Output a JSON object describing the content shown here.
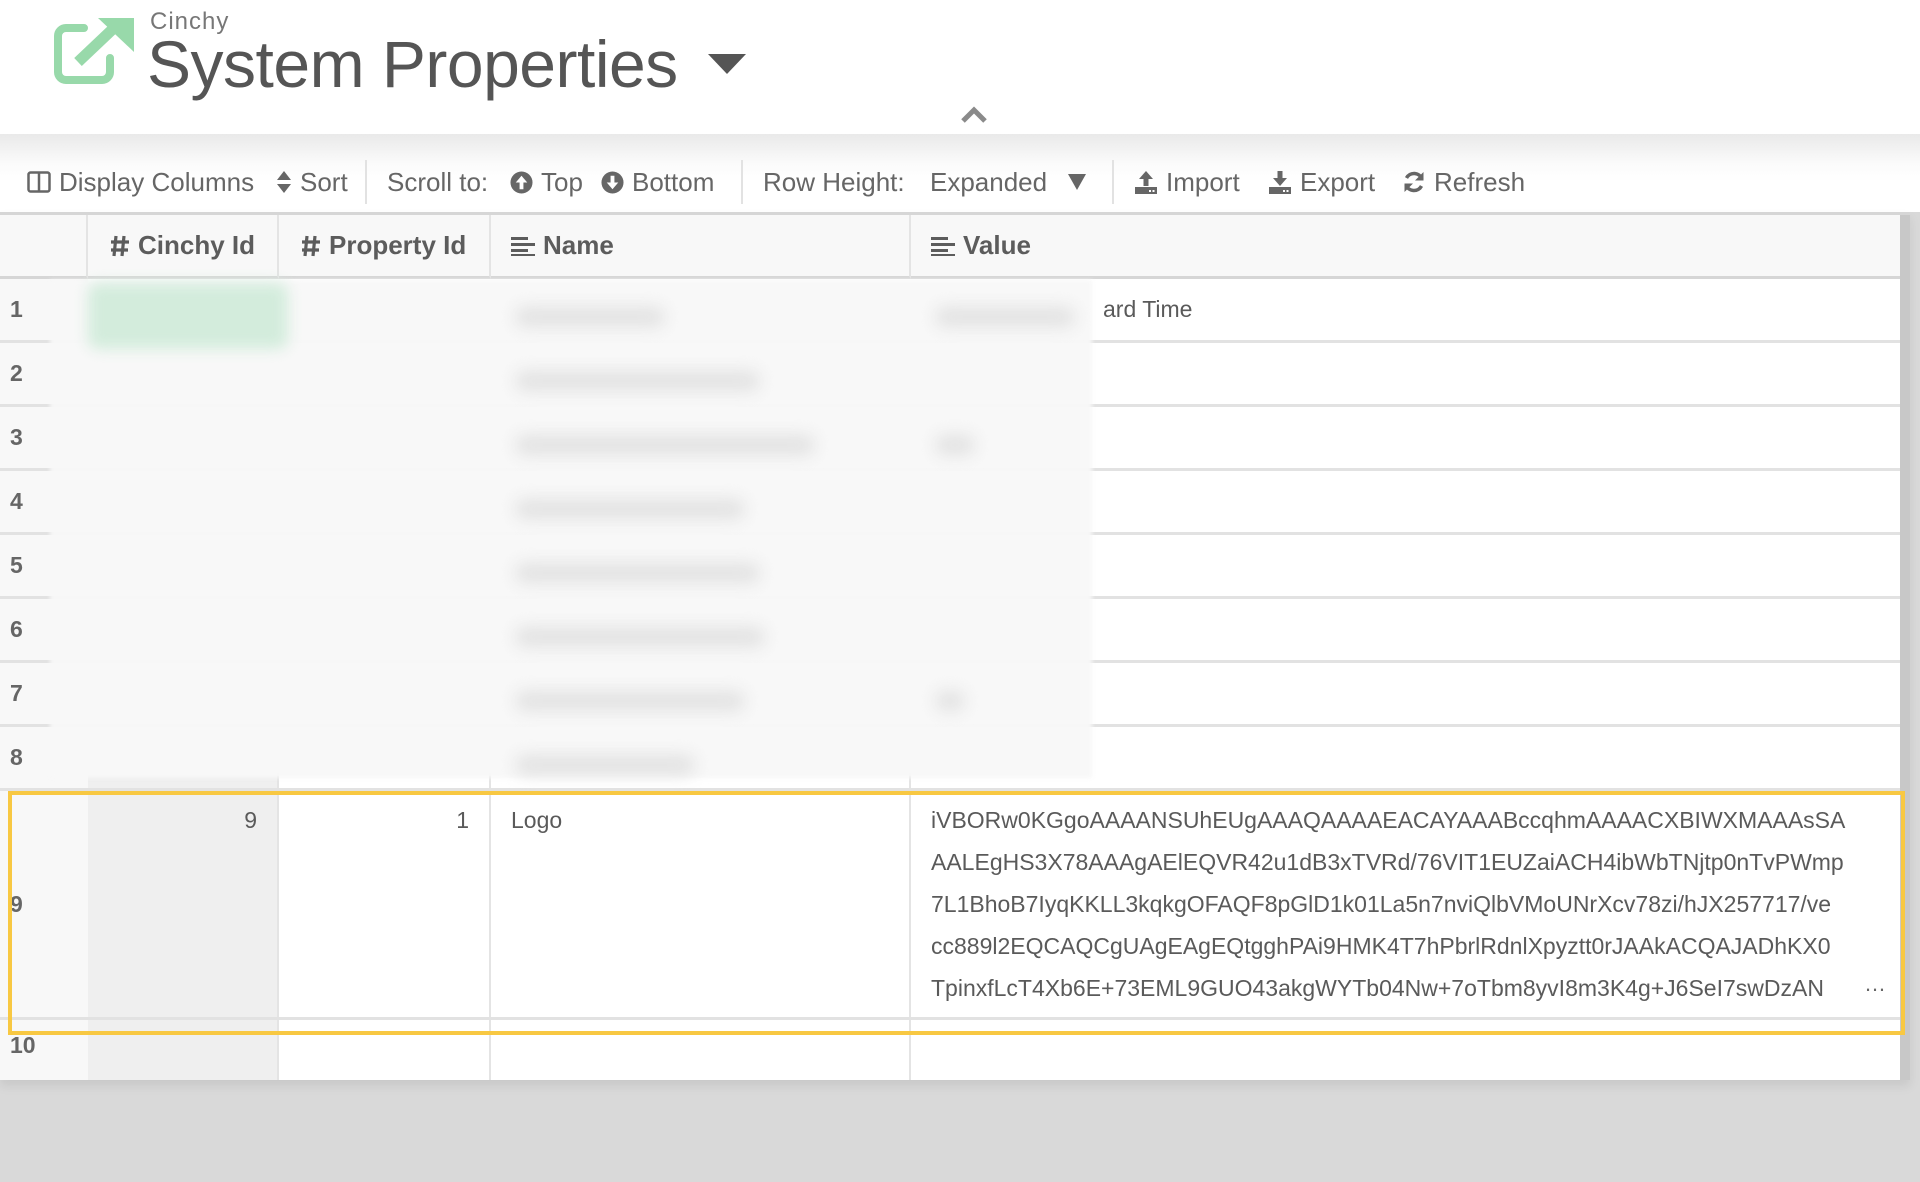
{
  "header": {
    "brand": "Cinchy",
    "title": "System Properties",
    "colors": {
      "logo": "#98D9AA",
      "highlight": "#F8C842"
    }
  },
  "toolbar": {
    "display_columns": "Display Columns",
    "sort": "Sort",
    "scroll_to_label": "Scroll to:",
    "top": "Top",
    "bottom": "Bottom",
    "row_height_label": "Row Height:",
    "row_height_value": "Expanded",
    "import": "Import",
    "export": "Export",
    "refresh": "Refresh"
  },
  "grid": {
    "columns": [
      {
        "label": "Cinchy Id",
        "type_icon": "hash-icon"
      },
      {
        "label": "Property Id",
        "type_icon": "hash-icon"
      },
      {
        "label": "Name",
        "type_icon": "text-lines-icon"
      },
      {
        "label": "Value",
        "type_icon": "text-lines-icon"
      }
    ],
    "row_numbers": [
      "1",
      "2",
      "3",
      "4",
      "5",
      "6",
      "7",
      "8",
      "9",
      "10"
    ],
    "row1_value_visible_fragment": "ard Time",
    "highlighted_row": {
      "row_number": "9",
      "cinchy_id": "9",
      "property_id": "1",
      "name": "Logo",
      "value_lines": [
        "iVBORw0KGgoAAAANSUhEUgAAAQAAAAEACAYAAABccqhmAAAACXBIWXMAAAsSA",
        "AALEgHS3X78AAAgAElEQVR42u1dB3xTVRd/76VIT1EUZaiACH4ibWbTNjtp0nTvPWmp",
        "7L1BhoB7IyqKKLL3kqkgOFAQF8pGlD1k01La5n7nviQlbVMoUNrXcv78zi/hJX257717/ve",
        "cc889l2EQCAQCgUAgEAgEQtgghPAi9HMK4T7hPbrlRdnlXpyztt0rJAAkACQAJADhKX0",
        "TpinxfLcT4Xb6E+73EML9GUO43akgWYTb04Nw+7oTbm8yvI8m3K4g+J6SeI7swDzAN"
      ],
      "value_overflow": "…"
    },
    "row10": {
      "row_number": "10"
    }
  }
}
